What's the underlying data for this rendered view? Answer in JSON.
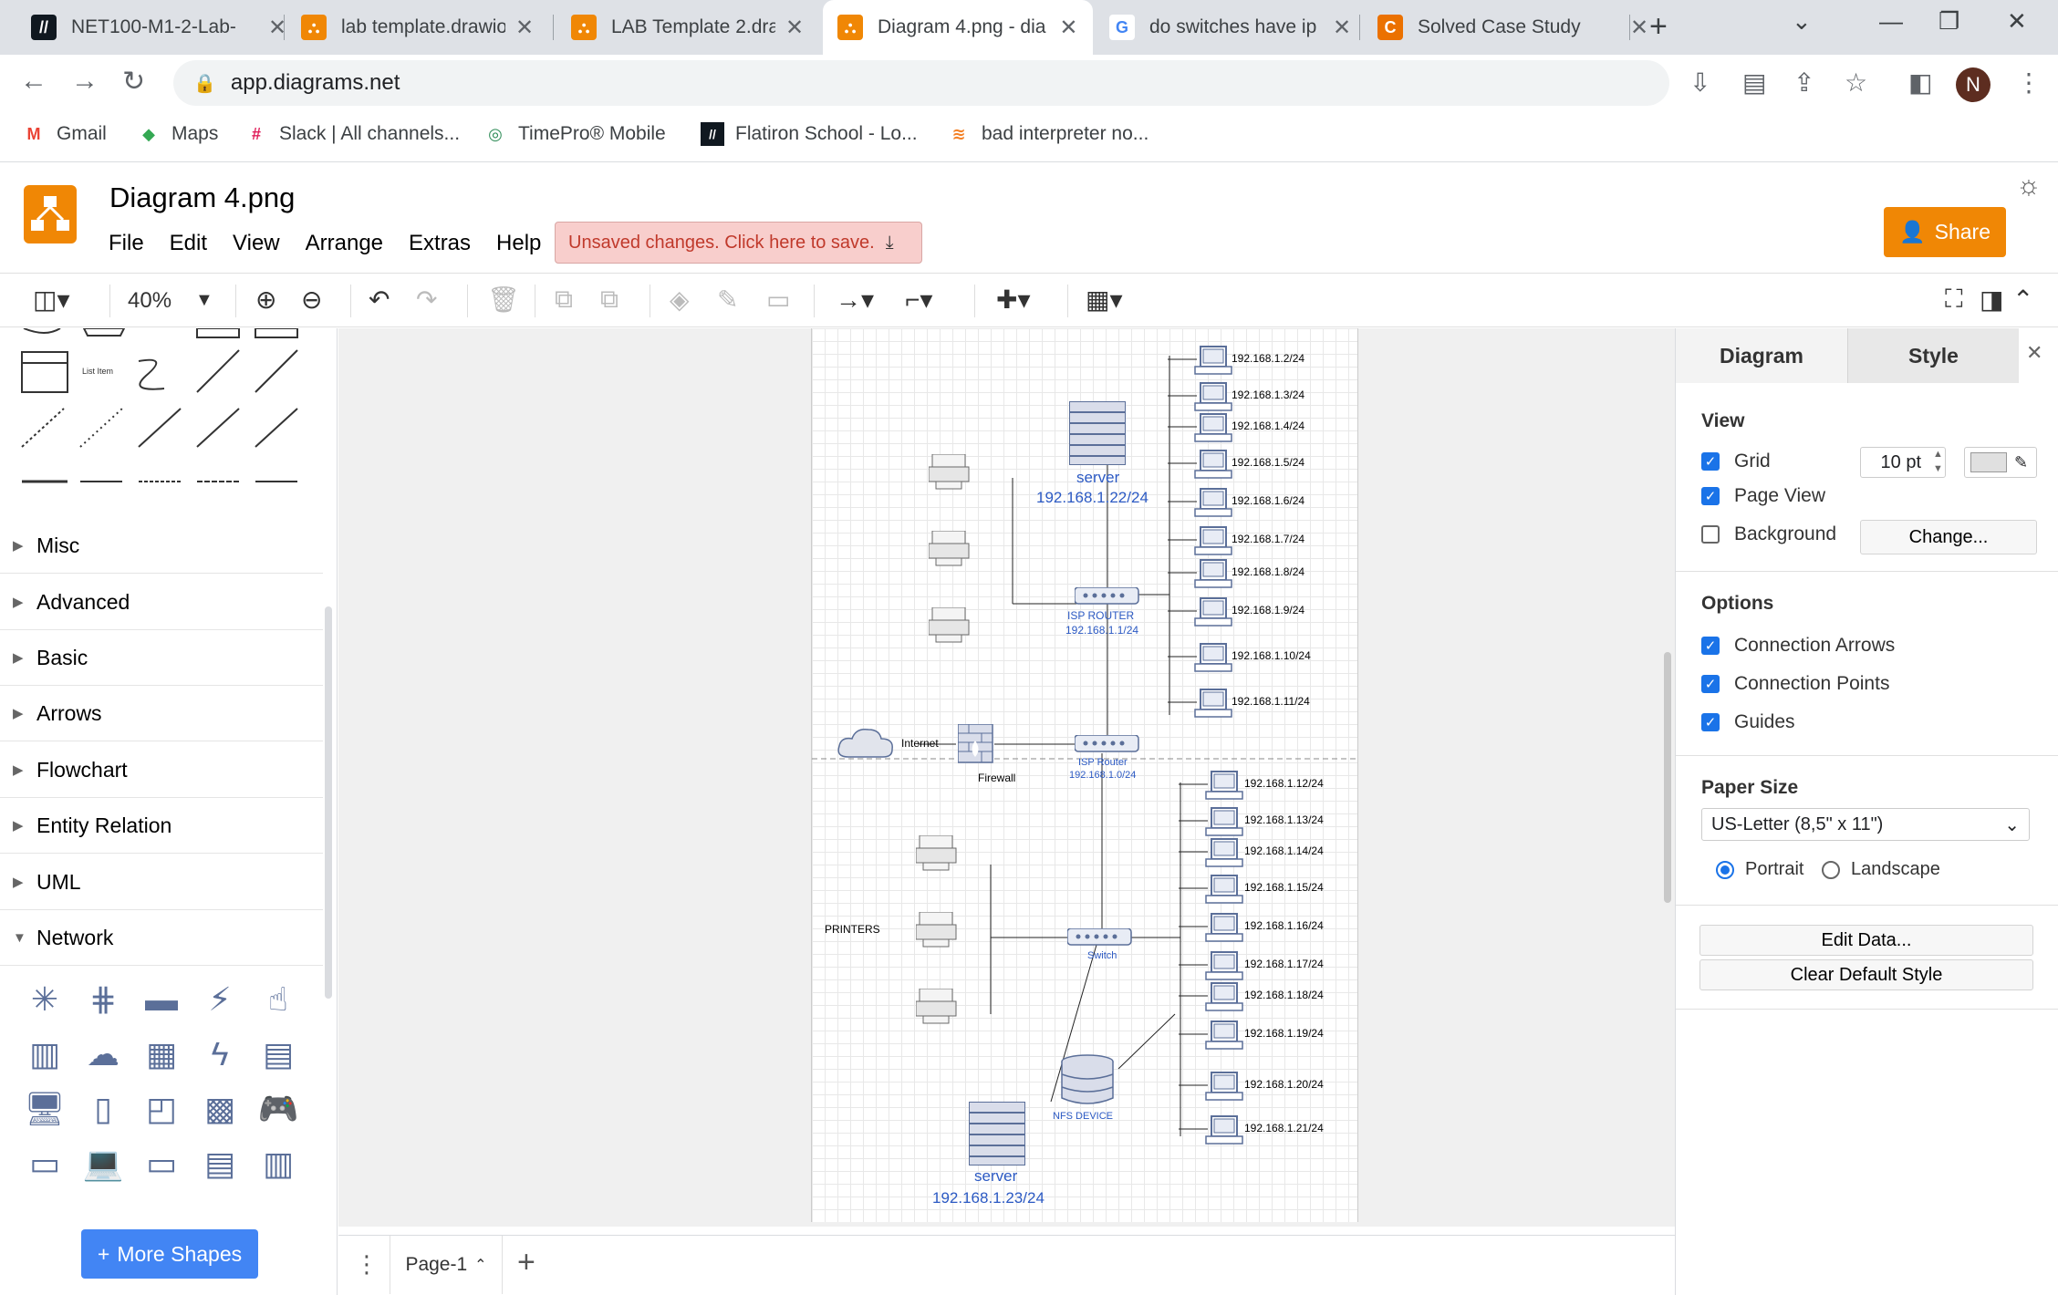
{
  "browser": {
    "tabs": [
      {
        "label": "NET100-M1-2-Lab-",
        "icon": "flatiron-icon"
      },
      {
        "label": "lab template.drawio",
        "icon": "drawio-icon"
      },
      {
        "label": "LAB Template 2.dra",
        "icon": "drawio-icon"
      },
      {
        "label": "Diagram 4.png - dia",
        "icon": "drawio-icon"
      },
      {
        "label": "do switches have ip",
        "icon": "google-icon"
      },
      {
        "label": "Solved Case Study",
        "icon": "chegg-icon"
      }
    ],
    "url": "app.diagrams.net",
    "avatar_initial": "N",
    "bookmarks": [
      "Gmail",
      "Maps",
      "Slack | All channels...",
      "TimePro® Mobile",
      "Flatiron School - Lo...",
      "bad interpreter no..."
    ]
  },
  "app": {
    "title": "Diagram 4.png",
    "menu": [
      "File",
      "Edit",
      "View",
      "Arrange",
      "Extras",
      "Help"
    ],
    "unsaved": "Unsaved changes. Click here to save.",
    "share": "Share",
    "zoom": "40%"
  },
  "sidebar": {
    "list_item_label": "List Item",
    "categories": [
      "Misc",
      "Advanced",
      "Basic",
      "Arrows",
      "Flowchart",
      "Entity Relation",
      "UML",
      "Network"
    ],
    "more_shapes": "More Shapes"
  },
  "diagram": {
    "server_top": {
      "name": "server",
      "ip": "192.168.1.22/24"
    },
    "server_bottom": {
      "name": "server",
      "ip": "192.168.1.23/24"
    },
    "isp_router_top": {
      "name": "ISP ROUTER",
      "ip": "192.168.1.1/24"
    },
    "isp_router_mid": {
      "name": "ISP Router",
      "ip": "192.168.1.0/24"
    },
    "internet": "Internet",
    "firewall": "Firewall",
    "printers": "PRINTERS",
    "switch": "Switch",
    "nfs": "NFS DEVICE",
    "top_hosts": [
      "192.168.1.2/24",
      "192.168.1.3/24",
      "192.168.1.4/24",
      "192.168.1.5/24",
      "192.168.1.6/24",
      "192.168.1.7/24",
      "192.168.1.8/24",
      "192.168.1.9/24",
      "192.168.1.10/24",
      "192.168.1.11/24"
    ],
    "bottom_hosts": [
      "192.168.1.12/24",
      "192.168.1.13/24",
      "192.168.1.14/24",
      "192.168.1.15/24",
      "192.168.1.16/24",
      "192.168.1.17/24",
      "192.168.1.18/24",
      "192.168.1.19/24",
      "192.168.1.20/24",
      "192.168.1.21/24"
    ]
  },
  "pages": {
    "current": "Page-1"
  },
  "format_panel": {
    "tabs": [
      "Diagram",
      "Style"
    ],
    "view_title": "View",
    "grid": {
      "label": "Grid",
      "checked": true,
      "size": "10 pt"
    },
    "page_view": {
      "label": "Page View",
      "checked": true
    },
    "background": {
      "label": "Background",
      "checked": false,
      "button": "Change..."
    },
    "options_title": "Options",
    "options": [
      {
        "label": "Connection Arrows",
        "checked": true
      },
      {
        "label": "Connection Points",
        "checked": true
      },
      {
        "label": "Guides",
        "checked": true
      }
    ],
    "paper_title": "Paper Size",
    "paper_size": "US-Letter (8,5\" x 11\")",
    "orientation": {
      "portrait": "Portrait",
      "landscape": "Landscape",
      "selected": "Portrait"
    },
    "edit_data": "Edit Data...",
    "clear_style": "Clear Default Style"
  },
  "colors": {
    "drawio_orange": "#f08705",
    "chrome_blue": "#1a73e8",
    "unsaved_bg": "#f8cecc",
    "more_shapes": "#4285f4"
  }
}
